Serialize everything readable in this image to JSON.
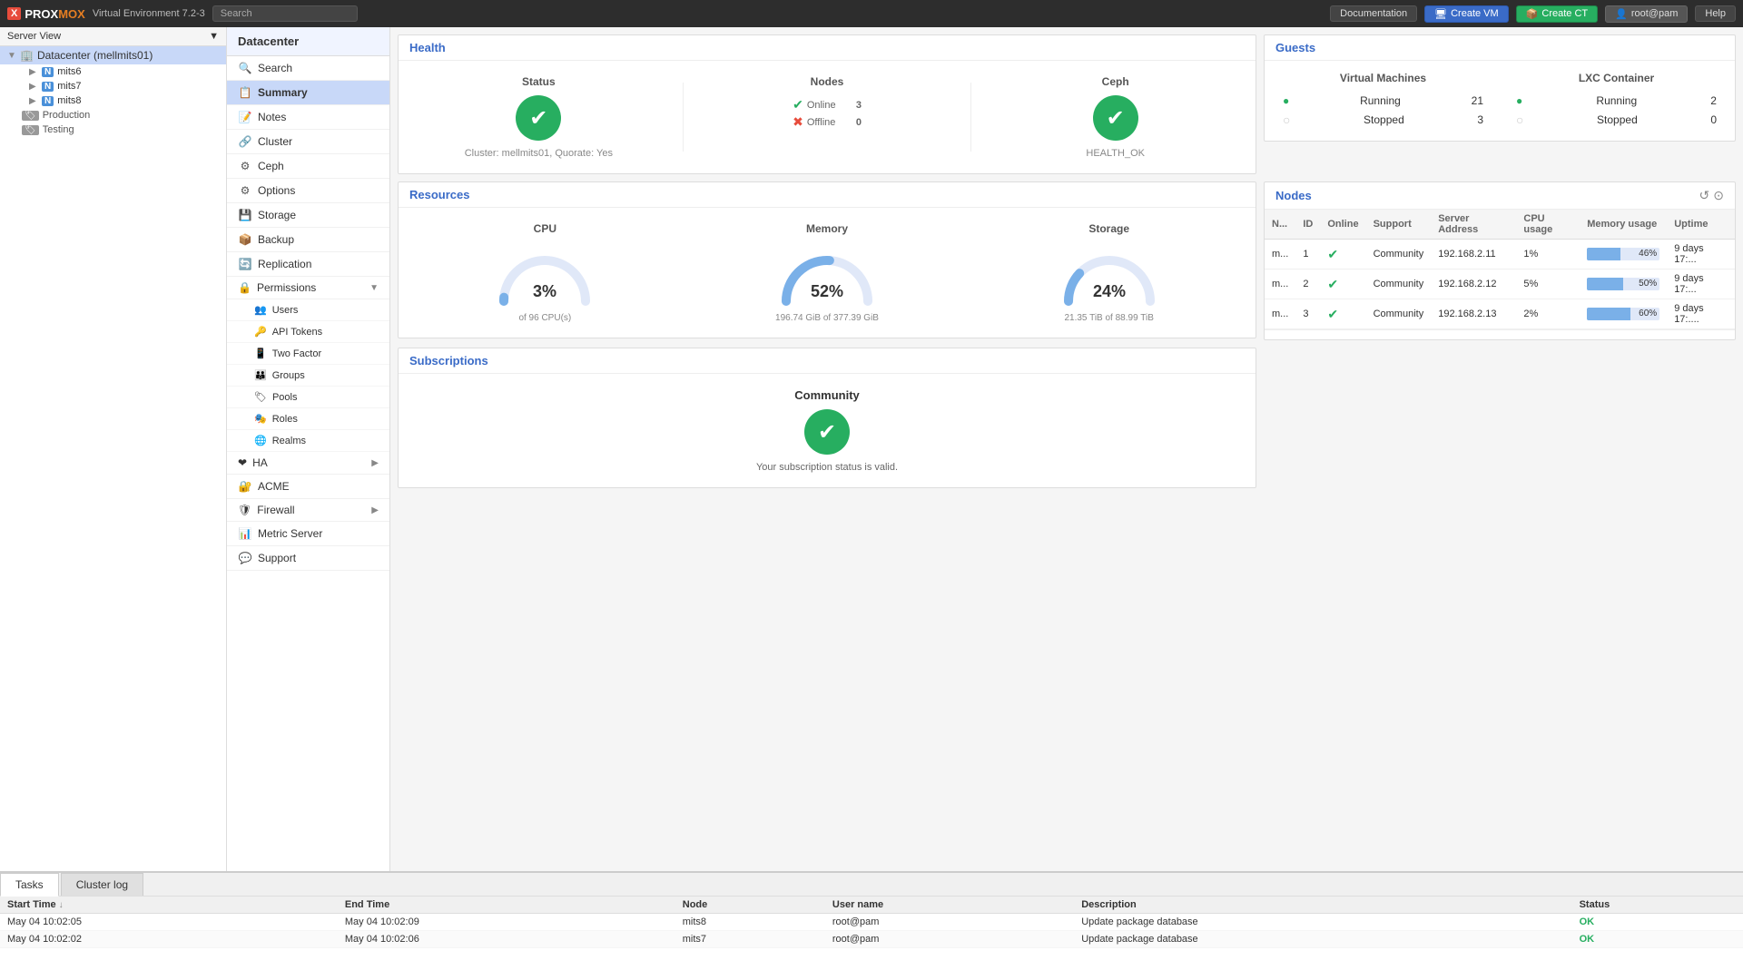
{
  "topbar": {
    "logo_x": "X",
    "logo_prox": "PROX",
    "logo_mox": "MOX",
    "app_title": "Virtual Environment 7.2-3",
    "search_placeholder": "Search",
    "doc_btn": "Documentation",
    "create_vm_btn": "Create VM",
    "create_ct_btn": "Create CT",
    "user_btn": "root@pam",
    "help_btn": "Help"
  },
  "sidebar": {
    "server_view_label": "Server View",
    "datacenter_label": "Datacenter (mellmits01)",
    "nodes": [
      {
        "id": "mits6",
        "label": "mits6"
      },
      {
        "id": "mits7",
        "label": "mits7"
      },
      {
        "id": "mits8",
        "label": "mits8"
      }
    ],
    "tags": [
      {
        "label": "Production"
      },
      {
        "label": "Testing"
      }
    ]
  },
  "nav": {
    "datacenter_title": "Datacenter",
    "items": [
      {
        "id": "search",
        "label": "Search",
        "icon": "🔍"
      },
      {
        "id": "summary",
        "label": "Summary",
        "icon": "📋"
      },
      {
        "id": "notes",
        "label": "Notes",
        "icon": "📝"
      },
      {
        "id": "cluster",
        "label": "Cluster",
        "icon": "🔗"
      },
      {
        "id": "ceph",
        "label": "Ceph",
        "icon": "⚙"
      },
      {
        "id": "options",
        "label": "Options",
        "icon": "⚙"
      },
      {
        "id": "storage",
        "label": "Storage",
        "icon": "💾"
      },
      {
        "id": "backup",
        "label": "Backup",
        "icon": "📦"
      },
      {
        "id": "replication",
        "label": "Replication",
        "icon": "🔄"
      },
      {
        "id": "permissions",
        "label": "Permissions",
        "icon": "🔒",
        "has_children": true
      },
      {
        "id": "ha",
        "label": "HA",
        "icon": "❤",
        "has_children": true
      },
      {
        "id": "acme",
        "label": "ACME",
        "icon": "🔐"
      },
      {
        "id": "firewall",
        "label": "Firewall",
        "icon": "🛡",
        "has_children": true
      },
      {
        "id": "metric_server",
        "label": "Metric Server",
        "icon": "📊"
      },
      {
        "id": "support",
        "label": "Support",
        "icon": "💬"
      }
    ],
    "permissions_children": [
      {
        "label": "Users"
      },
      {
        "label": "API Tokens"
      },
      {
        "label": "Two Factor"
      },
      {
        "label": "Groups"
      },
      {
        "label": "Pools"
      },
      {
        "label": "Roles"
      },
      {
        "label": "Realms"
      }
    ]
  },
  "health": {
    "title": "Health",
    "status_title": "Status",
    "nodes_title": "Nodes",
    "ceph_title": "Ceph",
    "cluster_info": "Cluster: mellmits01, Quorate: Yes",
    "ceph_status": "HEALTH_OK",
    "online_label": "Online",
    "online_count": "3",
    "offline_label": "Offline",
    "offline_count": "0"
  },
  "resources": {
    "title": "Resources",
    "cpu_title": "CPU",
    "cpu_percent": "3%",
    "cpu_detail": "of 96 CPU(s)",
    "cpu_value": 3,
    "memory_title": "Memory",
    "memory_percent": "52%",
    "memory_detail": "196.74 GiB of 377.39 GiB",
    "memory_value": 52,
    "storage_title": "Storage",
    "storage_percent": "24%",
    "storage_detail": "21.35 TiB of 88.99 TiB",
    "storage_value": 24
  },
  "guests": {
    "title": "Guests",
    "vm_title": "Virtual Machines",
    "lxc_title": "LXC Container",
    "vm_running_label": "Running",
    "vm_running_count": "21",
    "vm_stopped_label": "Stopped",
    "vm_stopped_count": "3",
    "lxc_running_label": "Running",
    "lxc_running_count": "2",
    "lxc_stopped_label": "Stopped",
    "lxc_stopped_count": "0"
  },
  "nodes": {
    "title": "Nodes",
    "cols": [
      "N...",
      "ID",
      "Online",
      "Support",
      "Server Address",
      "CPU usage",
      "Memory usage",
      "Uptime"
    ],
    "rows": [
      {
        "name": "m...",
        "id": "1",
        "online": true,
        "support": "Community",
        "address": "192.168.2.11",
        "cpu": "1%",
        "cpu_val": 1,
        "memory": "46%",
        "memory_val": 46,
        "uptime": "9 days 17:..."
      },
      {
        "name": "m...",
        "id": "2",
        "online": true,
        "support": "Community",
        "address": "192.168.2.12",
        "cpu": "5%",
        "cpu_val": 5,
        "memory": "50%",
        "memory_val": 50,
        "uptime": "9 days 17:..."
      },
      {
        "name": "m...",
        "id": "3",
        "online": true,
        "support": "Community",
        "address": "192.168.2.13",
        "cpu": "2%",
        "cpu_val": 2,
        "memory": "60%",
        "memory_val": 60,
        "uptime": "9 days 17:...."
      }
    ]
  },
  "subscriptions": {
    "title": "Subscriptions",
    "plan_label": "Community",
    "status_text": "Your subscription status is valid."
  },
  "tasks": {
    "tab_tasks": "Tasks",
    "tab_cluster_log": "Cluster log",
    "cols": [
      "Start Time",
      "End Time",
      "Node",
      "User name",
      "Description",
      "Status"
    ],
    "rows": [
      {
        "start": "May 04 10:02:05",
        "end": "May 04 10:02:09",
        "node": "mits8",
        "user": "root@pam",
        "desc": "Update package database",
        "status": "OK"
      },
      {
        "start": "May 04 10:02:02",
        "end": "May 04 10:02:06",
        "node": "mits7",
        "user": "root@pam",
        "desc": "Update package database",
        "status": "OK"
      }
    ]
  }
}
